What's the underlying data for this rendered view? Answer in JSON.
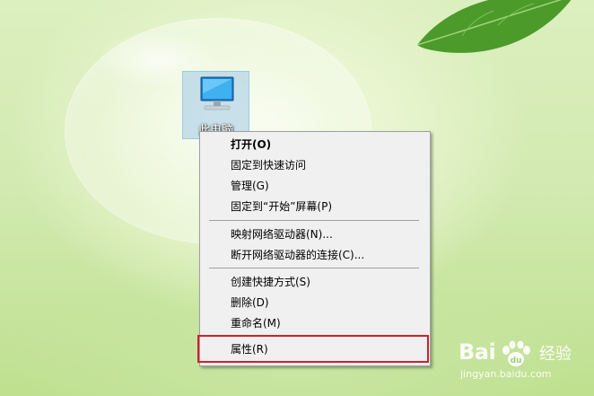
{
  "desktop": {
    "icon_label": "此电脑",
    "icon_name": "computer-monitor-icon"
  },
  "context_menu": {
    "items": [
      {
        "label": "打开(O)",
        "bold": true
      },
      {
        "label": "固定到快速访问"
      },
      {
        "label": "管理(G)"
      },
      {
        "label": "固定到“开始”屏幕(P)"
      },
      {
        "label": "映射网络驱动器(N)..."
      },
      {
        "label": "断开网络驱动器的连接(C)..."
      },
      {
        "label": "创建快捷方式(S)"
      },
      {
        "label": "删除(D)"
      },
      {
        "label": "重命名(M)"
      },
      {
        "label": "属性(R)",
        "highlighted": true
      }
    ],
    "highlight_color": "#d0202c"
  },
  "watermark": {
    "brand_text_a": "Bai",
    "brand_text_b": "经验",
    "site": "jingyan.baidu.com"
  }
}
